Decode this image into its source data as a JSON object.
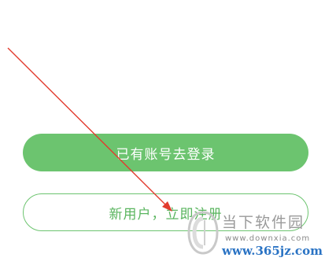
{
  "buttons": {
    "login_label": "已有账号去登录",
    "register_label": "新用户，立即注册"
  },
  "watermark": {
    "title": "当下软件园",
    "url": "www.downxia.com",
    "domain": "www.365jz.com"
  },
  "colors": {
    "accent": "#6cc46f",
    "annotation_arrow": "#e23b2e",
    "watermark_blue": "#2a73c4"
  }
}
